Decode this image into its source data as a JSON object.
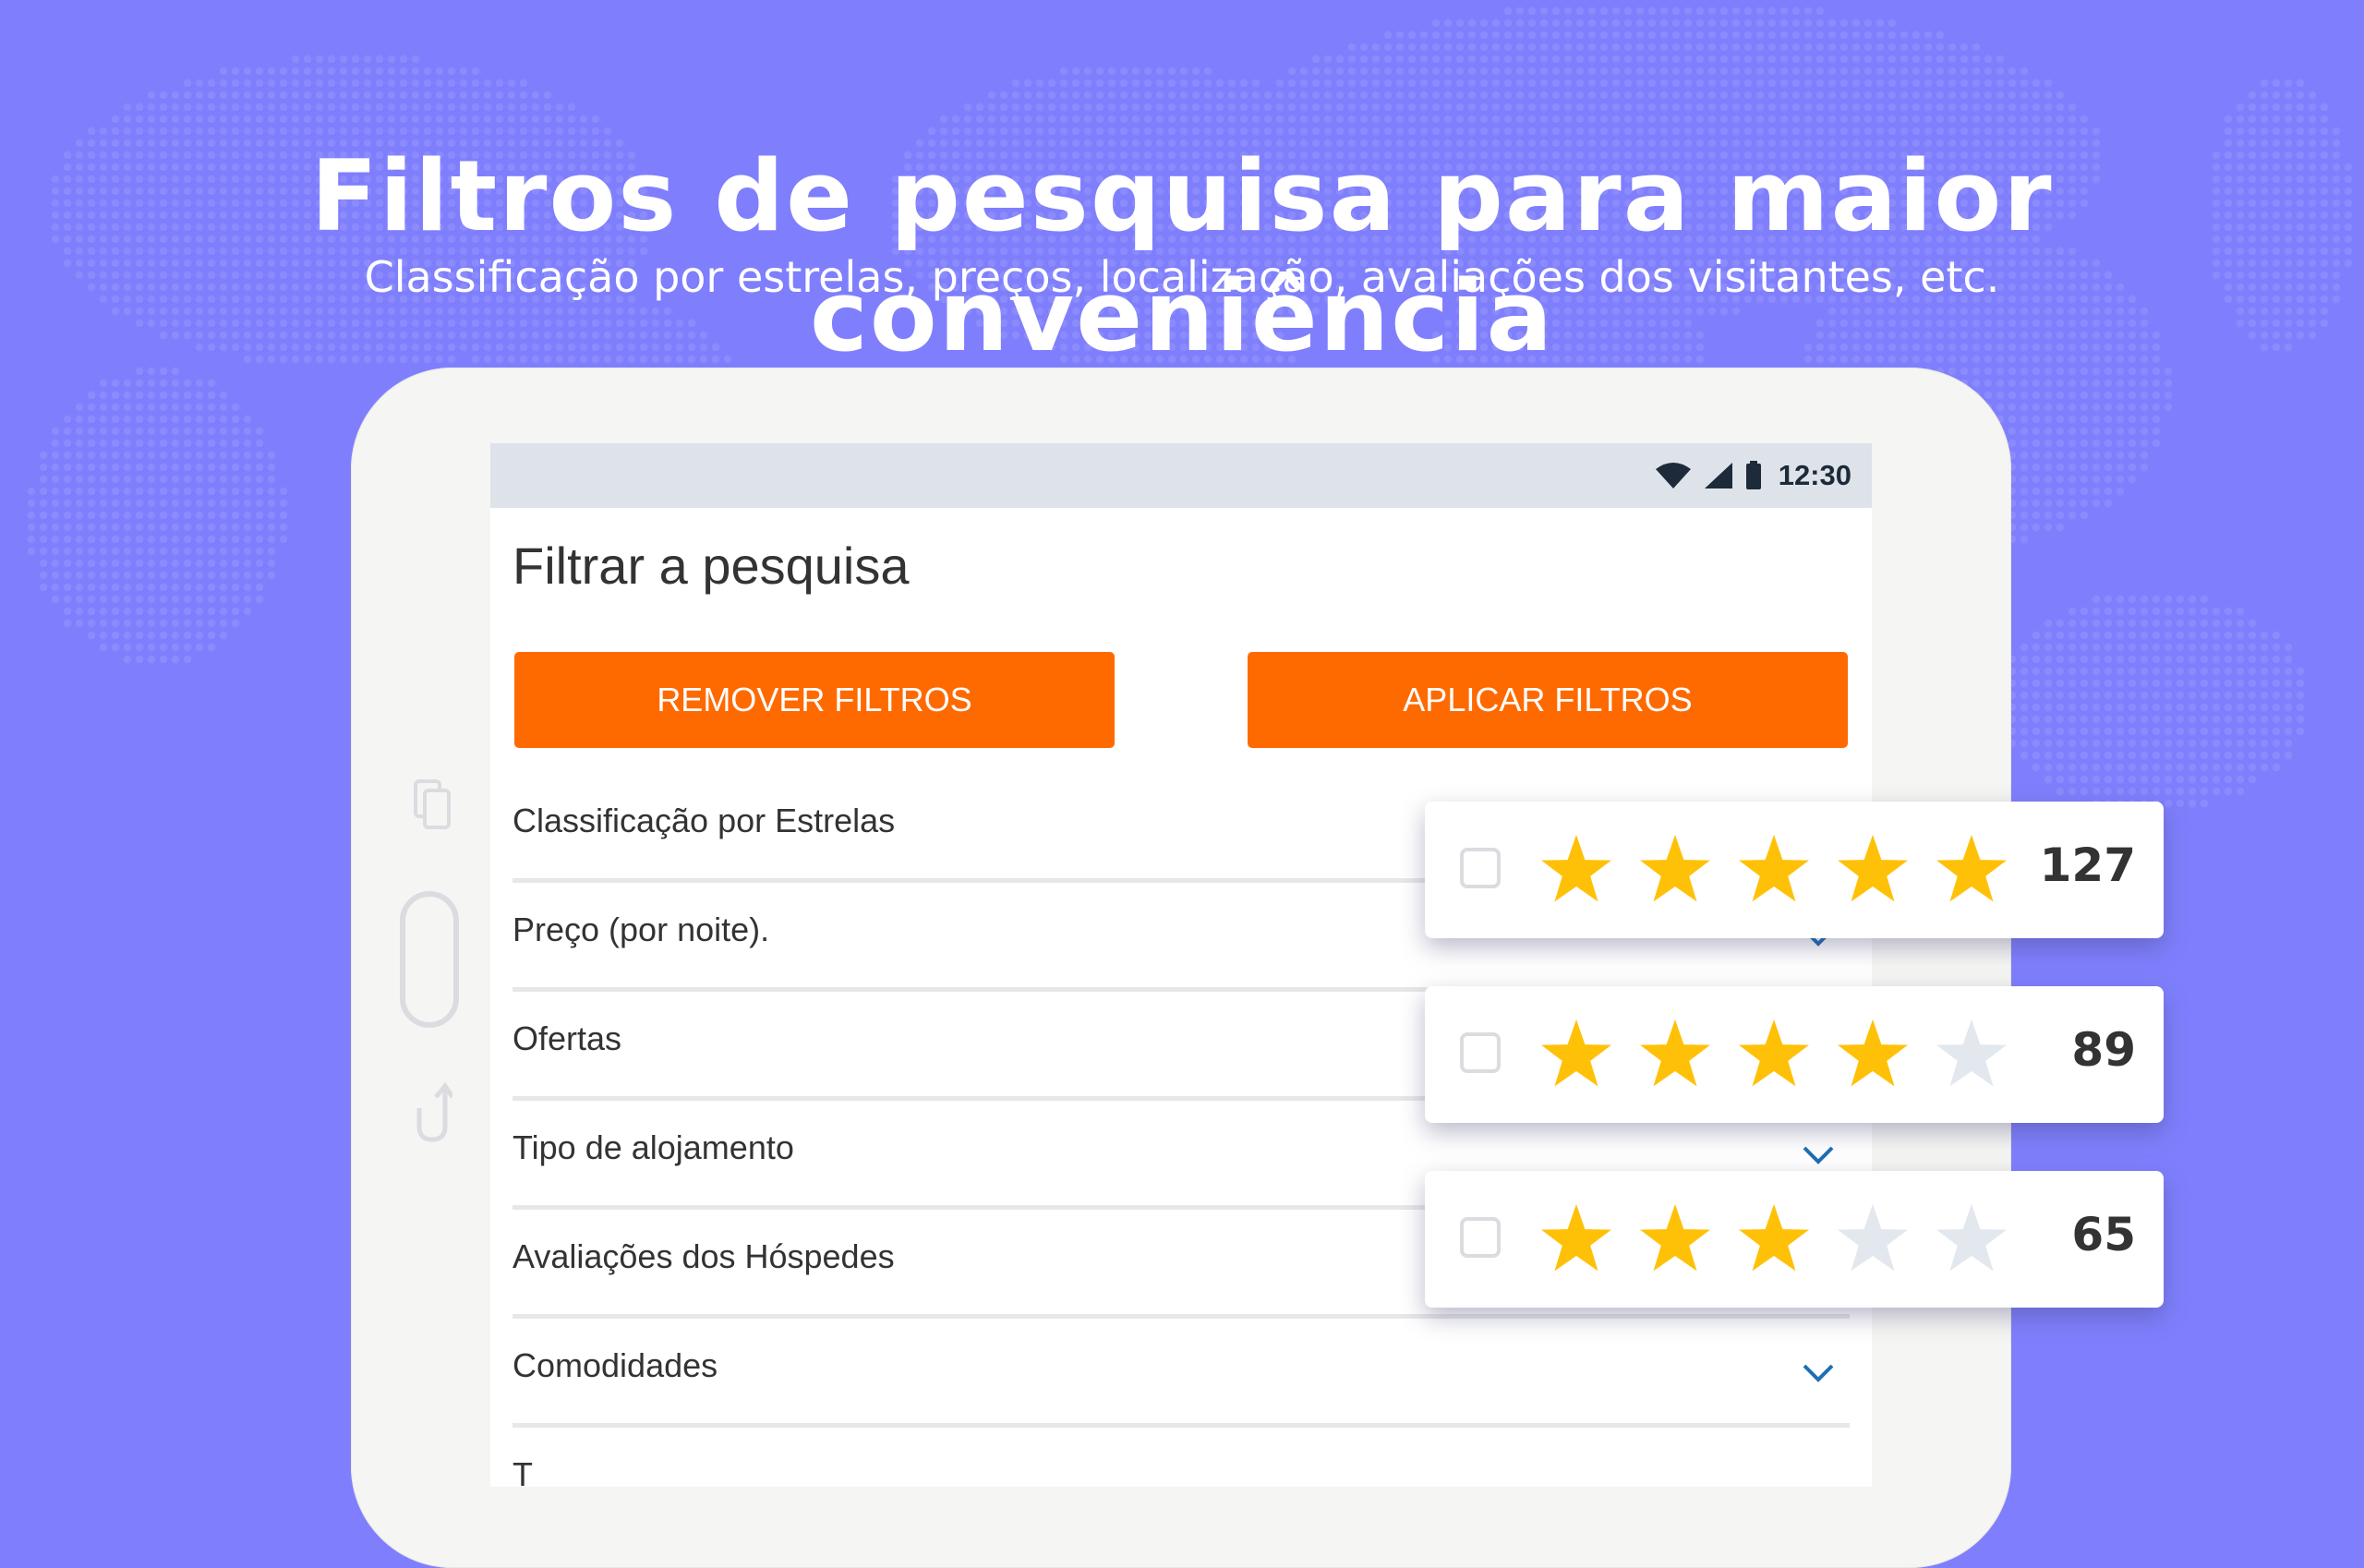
{
  "colors": {
    "background": "#7f7ffd",
    "accent_orange": "#ff6a00",
    "star_filled": "#ffc107",
    "star_empty": "#e3e7ee",
    "chevron": "#1f6fb5"
  },
  "hero": {
    "title": "Filtros de pesquisa para maior conveniência",
    "subtitle": "Classificação por estrelas, preços, localização, avaliações dos visitantes, etc."
  },
  "status_bar": {
    "time": "12:30",
    "icons": [
      "wifi-icon",
      "signal-icon",
      "battery-icon"
    ]
  },
  "screen": {
    "title": "Filtrar a pesquisa",
    "remove_label": "REMOVER FILTROS",
    "apply_label": "APLICAR FILTROS",
    "filters": [
      {
        "label": "Classificação por Estrelas"
      },
      {
        "label": "Preço (por noite)."
      },
      {
        "label": "Ofertas"
      },
      {
        "label": "Tipo de alojamento"
      },
      {
        "label": "Avaliações dos Hóspedes"
      },
      {
        "label": "Comodidades"
      },
      {
        "label": "T"
      }
    ]
  },
  "star_ratings": [
    {
      "stars": 5,
      "count": "127"
    },
    {
      "stars": 4,
      "count": "89"
    },
    {
      "stars": 3,
      "count": "65"
    }
  ],
  "tablet_side_icons": [
    "recent-apps-icon",
    "home-button-icon",
    "back-icon"
  ]
}
